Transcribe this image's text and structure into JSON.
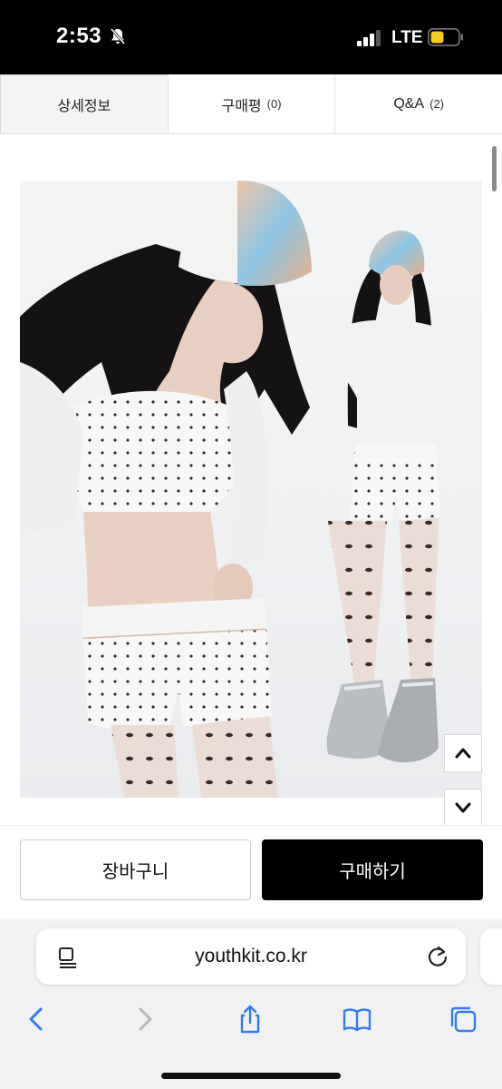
{
  "status_bar": {
    "time": "2:53",
    "network": "LTE",
    "icons": [
      "bell-slash-icon",
      "signal-icon",
      "battery-icon"
    ],
    "battery_color": "#f5cc1b"
  },
  "tabs": [
    {
      "label": "상세정보",
      "count": "",
      "active": true
    },
    {
      "label": "구매평",
      "count": "(0)",
      "active": false
    },
    {
      "label": "Q&A",
      "count": "(2)",
      "active": false
    }
  ],
  "content": {
    "image_alt": "product-photo",
    "scroll_up_icon": "chevron-up-icon",
    "scroll_down_icon": "chevron-down-icon"
  },
  "actions": {
    "cart_label": "장바구니",
    "buy_label": "구매하기"
  },
  "browser": {
    "url": "youthkit.co.kr",
    "icons": [
      "reader-icon",
      "reload-icon",
      "back-icon",
      "forward-icon",
      "share-icon",
      "bookmarks-icon",
      "tabs-icon"
    ],
    "accent_color": "#2f7cf6"
  }
}
